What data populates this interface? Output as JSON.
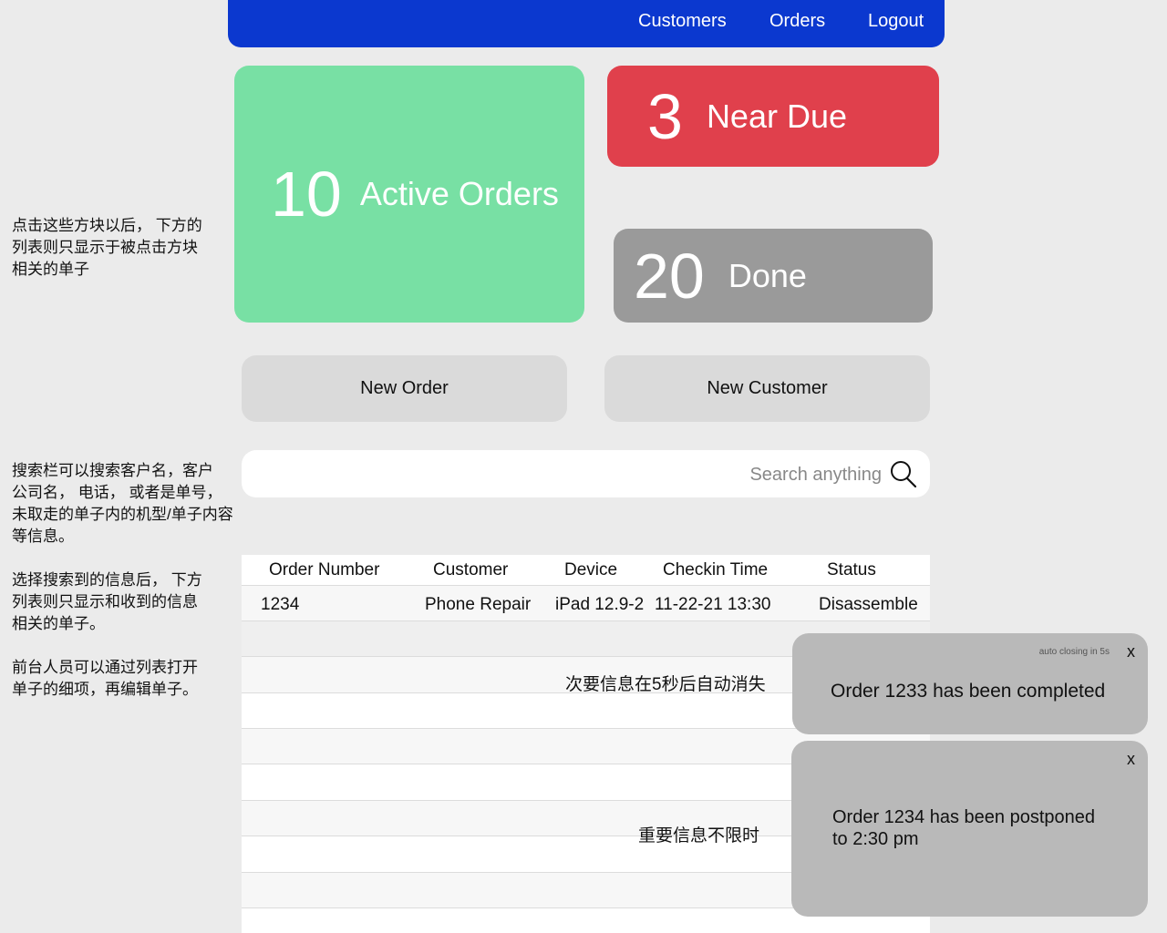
{
  "nav": {
    "customers": "Customers",
    "orders": "Orders",
    "logout": "Logout"
  },
  "tiles": {
    "active": {
      "count": "10",
      "label": "Active Orders",
      "color": "#78e0a4"
    },
    "near_due": {
      "count": "3",
      "label": "Near Due",
      "color": "#e0404c"
    },
    "done": {
      "count": "20",
      "label": "Done",
      "color": "#9a9a9a"
    }
  },
  "actions": {
    "new_order": "New Order",
    "new_customer": "New Customer"
  },
  "search": {
    "placeholder": "Search anything",
    "value": ""
  },
  "table": {
    "columns": [
      "Order Number",
      "Customer",
      "Device",
      "Checkin Time",
      "Status"
    ],
    "rows": [
      {
        "order_number": "1234",
        "customer": "Phone Repair",
        "device": "iPad 12.9-2",
        "checkin_time": "11-22-21  13:30",
        "status": "Disassemble"
      }
    ]
  },
  "annotations": {
    "tiles_note": "点击这些方块以后， 下方的\n列表则只显示于被点击方块\n相关的单子",
    "search_note": "搜索栏可以搜索客户名，客户\n公司名， 电话， 或者是单号，\n未取走的单子内的机型/单子内容\n等信息。",
    "select_note": "选择搜索到的信息后， 下方\n列表则只显示和收到的信息\n相关的单子。",
    "edit_note": "前台人员可以通过列表打开\n单子的细项，再编辑单子。",
    "minor_note": "次要信息在5秒后自动消失",
    "important_note": "重要信息不限时"
  },
  "toasts": [
    {
      "auto_close": "auto closing in 5s",
      "close": "x",
      "message": "Order 1233 has been completed"
    },
    {
      "close": "x",
      "message": "Order 1234 has been postponed\nto 2:30 pm"
    }
  ]
}
